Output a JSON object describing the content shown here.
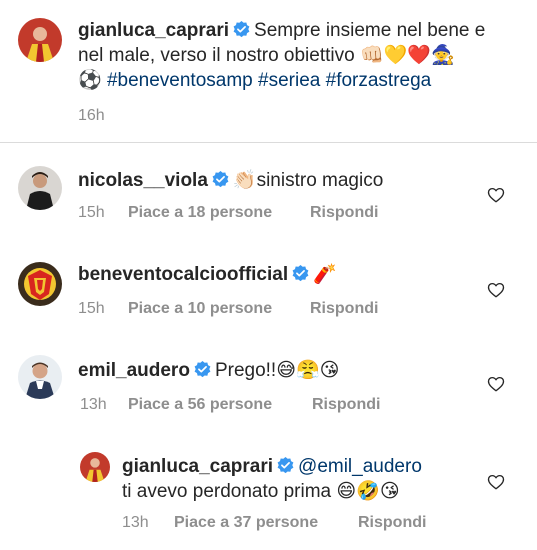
{
  "caption": {
    "username": "gianluca_caprari",
    "text_line1": "Sempre insieme nel bene e",
    "text_line2": "nel male, verso il nostro obiettivo",
    "emojis_line2": "👊🏻💛❤️🧙",
    "line3_emoji": "⚽",
    "hashtags": [
      "#beneventosamp",
      "#seriea",
      "#forzastrega"
    ],
    "time": "16h"
  },
  "comments": [
    {
      "username": "nicolas__viola",
      "text": "sinistro magico",
      "emoji_before": "👏🏻",
      "time": "15h",
      "likes": "Piace a 18 persone",
      "reply": "Rispondi"
    },
    {
      "username": "beneventocalcioofficial",
      "text": "",
      "emoji_after": "🧨",
      "time": "15h",
      "likes": "Piace a 10 persone",
      "reply": "Rispondi"
    },
    {
      "username": "emil_audero",
      "text": "Prego!!",
      "emoji_after": "😅😤😘",
      "time": "13h",
      "likes": "Piace a 56 persone",
      "reply": "Rispondi"
    }
  ],
  "reply": {
    "username": "gianluca_caprari",
    "mention": "@emil_audero",
    "text": "ti avevo perdonato prima",
    "emoji_after": "😄🤣😘",
    "time": "13h",
    "likes": "Piace a 37 persone",
    "reply": "Rispondi"
  },
  "colors": {
    "text": "#262626",
    "meta": "#8e8e8e",
    "link": "#00376b",
    "verified": "#3897f0"
  },
  "icons": {
    "verified": "verified-badge-icon",
    "like": "heart-outline-icon"
  }
}
